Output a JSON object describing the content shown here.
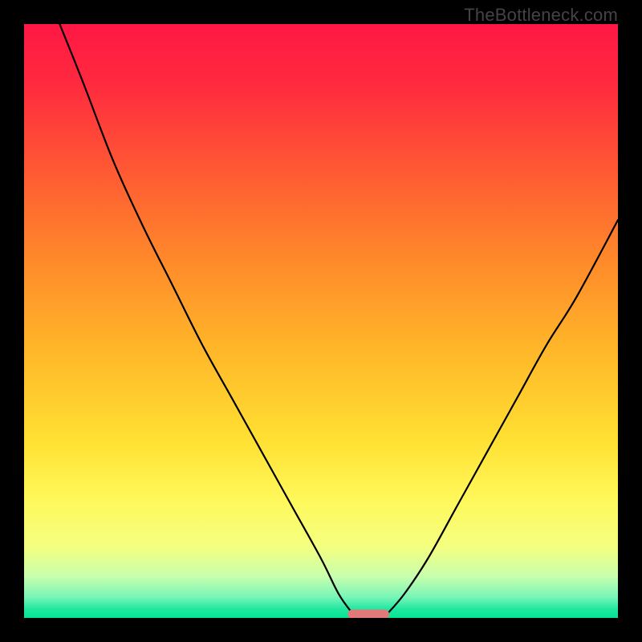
{
  "watermark": "TheBottleneck.com",
  "colors": {
    "background_black": "#000000",
    "curve_color": "#000000",
    "marker_color": "#e07a7a",
    "gradient_stops": [
      {
        "offset": 0.0,
        "color": "#ff1744"
      },
      {
        "offset": 0.1,
        "color": "#ff2a3f"
      },
      {
        "offset": 0.25,
        "color": "#ff5a33"
      },
      {
        "offset": 0.4,
        "color": "#ff8a2a"
      },
      {
        "offset": 0.55,
        "color": "#ffb729"
      },
      {
        "offset": 0.7,
        "color": "#ffe032"
      },
      {
        "offset": 0.8,
        "color": "#fff85a"
      },
      {
        "offset": 0.88,
        "color": "#f4ff80"
      },
      {
        "offset": 0.93,
        "color": "#c8ffad"
      },
      {
        "offset": 0.965,
        "color": "#78f5b8"
      },
      {
        "offset": 0.985,
        "color": "#22e7a0"
      },
      {
        "offset": 1.0,
        "color": "#00e593"
      }
    ]
  },
  "chart_data": {
    "type": "line",
    "title": "",
    "xlabel": "",
    "ylabel": "",
    "xlim": [
      0,
      100
    ],
    "ylim": [
      0,
      100
    ],
    "series": [
      {
        "name": "left-branch",
        "x": [
          6,
          10,
          15,
          20,
          25,
          30,
          35,
          40,
          45,
          50,
          53,
          55.5
        ],
        "y": [
          100,
          90,
          77,
          66,
          56,
          46,
          37,
          28,
          19,
          10,
          4,
          0.5
        ]
      },
      {
        "name": "right-branch",
        "x": [
          61,
          64,
          68,
          73,
          78,
          83,
          88,
          93,
          100
        ],
        "y": [
          0.5,
          4,
          10,
          19,
          28,
          37,
          46,
          54,
          67
        ]
      }
    ],
    "marker": {
      "x_center": 58,
      "x_halfwidth": 3.5,
      "y": 0.6
    }
  }
}
